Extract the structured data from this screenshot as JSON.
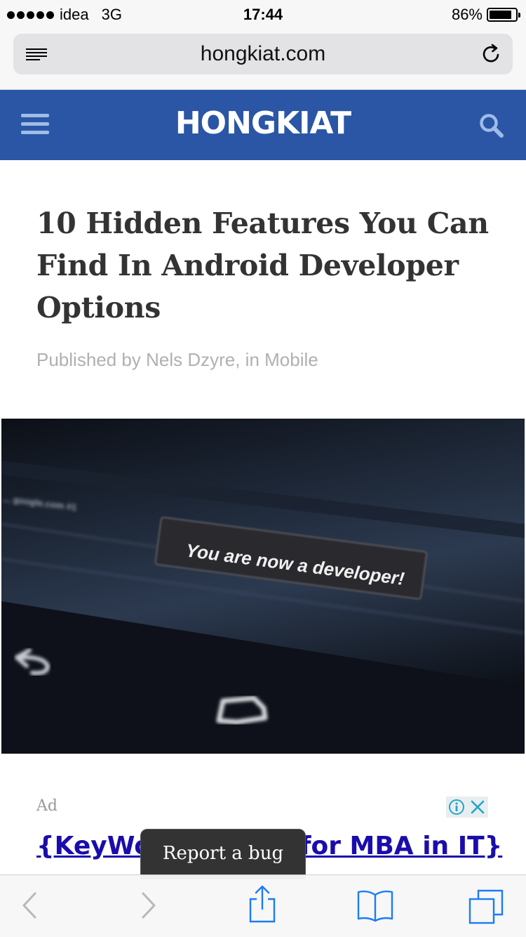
{
  "status_bar": {
    "carrier": "idea",
    "network": "3G",
    "time": "17:44",
    "battery_percent": "86%",
    "battery_level": 0.86
  },
  "browser": {
    "url": "hongkiat.com"
  },
  "site": {
    "logo": "HONGKIAT",
    "brand_color": "#2a56a5"
  },
  "article": {
    "title": "10 Hidden Features You Can Find In Android Developer Options",
    "byline": "Published by Nels Dzyre, in Mobile",
    "image_text": "You are now a developer!",
    "image_small_text": "... google.com #1"
  },
  "ad": {
    "label": "Ad",
    "headline": "{KeyWord} Guide for MBA in IT}"
  },
  "report_bug": {
    "label": "Report a bug"
  },
  "icons": [
    "reader-icon",
    "reload-icon",
    "menu-icon",
    "search-icon",
    "back-icon",
    "forward-icon",
    "share-icon",
    "bookmarks-icon",
    "tabs-icon",
    "info-icon",
    "close-icon"
  ]
}
